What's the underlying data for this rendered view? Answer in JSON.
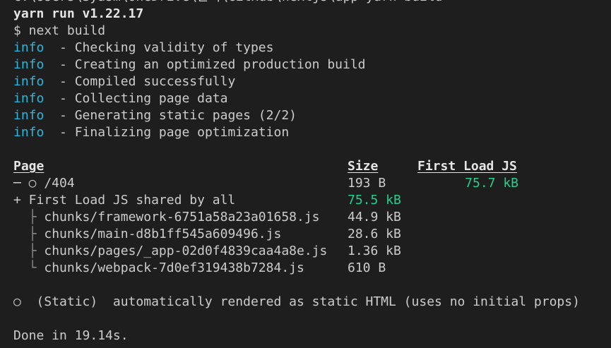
{
  "terminal": {
    "path_line": "C:\\Users\\Syasm\\OneDrive\\문서\\GitHub\\nextjs\\app>yarn build",
    "yarn_line": "yarn run v1.22.17",
    "command_line": "$ next build",
    "info_tag": "info",
    "info_messages": [
      "- Checking validity of types",
      "- Creating an optimized production build",
      "- Compiled successfully",
      "- Collecting page data",
      "- Generating static pages (2/2)",
      "- Finalizing page optimization"
    ],
    "table": {
      "headers": {
        "page": "Page",
        "size": "Size",
        "first_load": "First Load JS"
      },
      "route": {
        "marker": "─ ○ /404",
        "size": "193 B",
        "first_load": "75.7 kB"
      },
      "shared": {
        "label": "+ First Load JS shared by all",
        "size": "75.5 kB"
      },
      "chunks": [
        {
          "tree": "├",
          "name": "chunks/framework-6751a58a23a01658.js",
          "size": "44.9 kB"
        },
        {
          "tree": "├",
          "name": "chunks/main-d8b1ff545a609496.js",
          "size": "28.6 kB"
        },
        {
          "tree": "├",
          "name": "chunks/pages/_app-02d0f4839caa4a8e.js",
          "size": "1.36 kB"
        },
        {
          "tree": "└",
          "name": "chunks/webpack-7d0ef319438b7284.js",
          "size": "610 B"
        }
      ]
    },
    "legend": "○  (Static)  automatically rendered as static HTML (uses no initial props)",
    "done_line": "Done in 19.14s.",
    "colors": {
      "background": "#1e1e1e",
      "text": "#cccccc",
      "info": "#29b8db",
      "green": "#23d18b"
    }
  }
}
